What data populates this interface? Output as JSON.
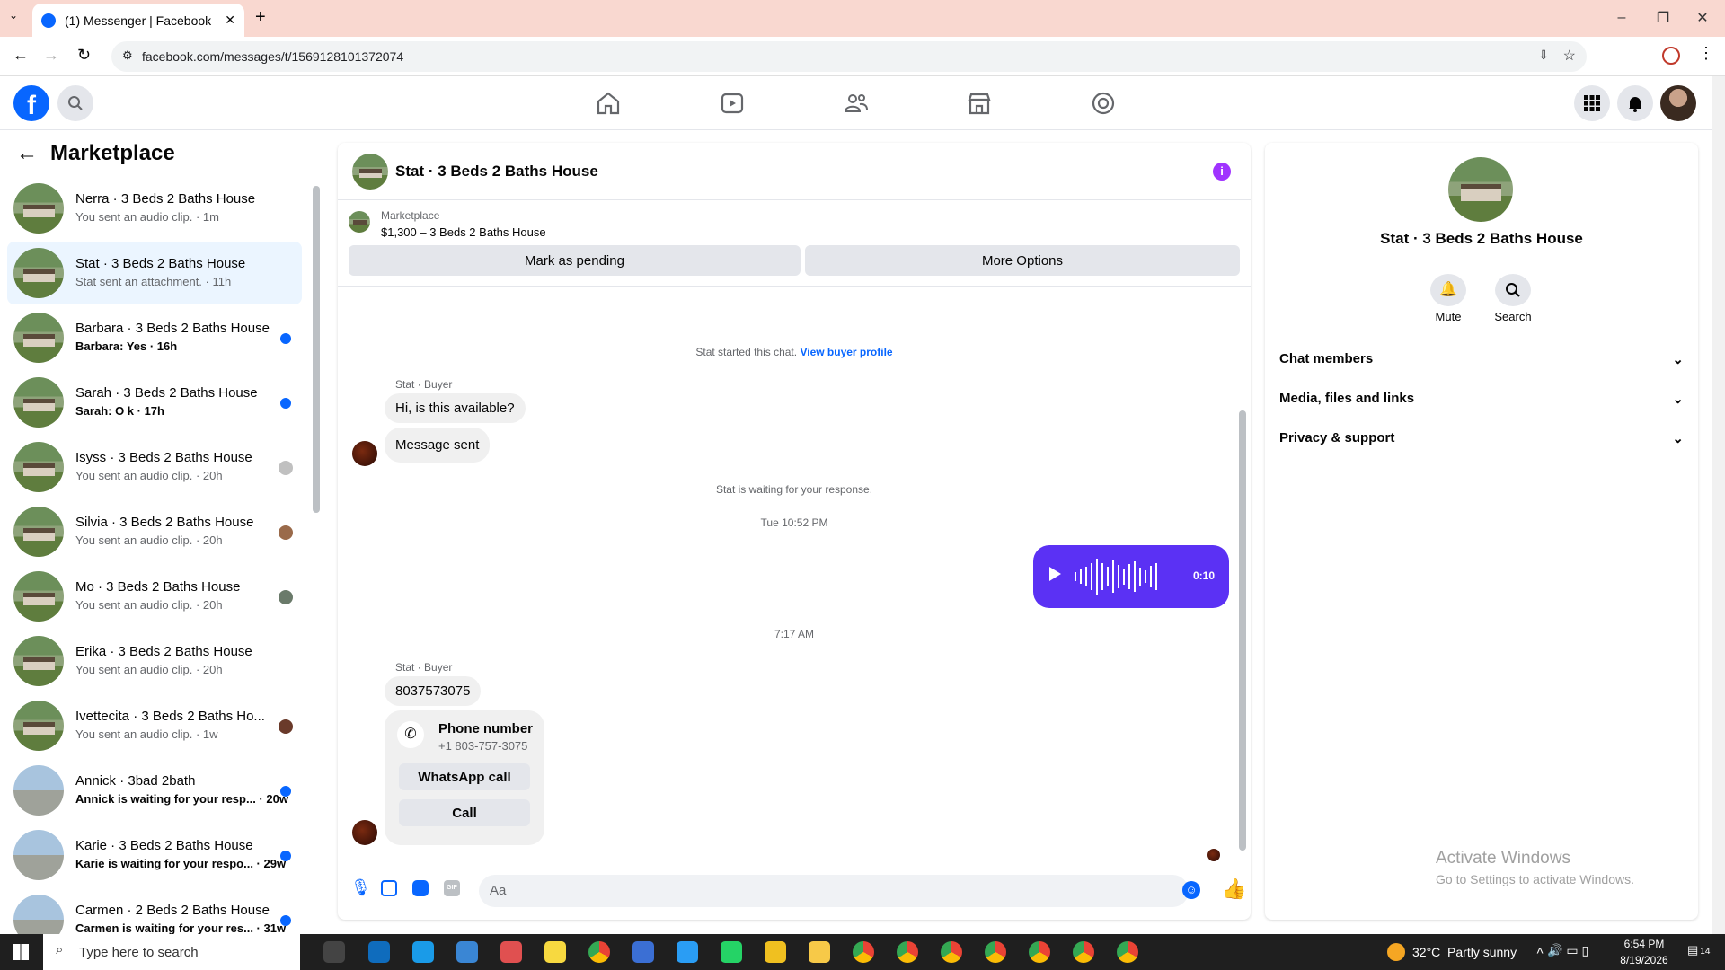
{
  "browser": {
    "tab_title": "(1) Messenger | Facebook",
    "url": "facebook.com/messages/t/1569128101372074"
  },
  "left": {
    "title": "Marketplace",
    "conversations": [
      {
        "name": "Nerra · 3 Beds 2 Baths House",
        "preview": "You sent an audio clip. · 1m",
        "unread": false
      },
      {
        "name": "Stat · 3 Beds 2 Baths House",
        "preview": "Stat sent an attachment. · 11h",
        "unread": false
      },
      {
        "name": "Barbara · 3 Beds 2 Baths House",
        "preview": "Barbara: Yes · 16h",
        "unread": true
      },
      {
        "name": "Sarah · 3 Beds 2 Baths House",
        "preview": "Sarah: O k · 17h",
        "unread": true
      },
      {
        "name": "Isyss · 3 Beds 2 Baths House",
        "preview": "You sent an audio clip. · 20h",
        "unread": false
      },
      {
        "name": "Silvia · 3 Beds 2 Baths House",
        "preview": "You sent an audio clip. · 20h",
        "unread": false
      },
      {
        "name": "Mo · 3 Beds 2 Baths House",
        "preview": "You sent an audio clip. · 20h",
        "unread": false
      },
      {
        "name": "Erika · 3 Beds 2 Baths House",
        "preview": "You sent an audio clip. · 20h",
        "unread": false
      },
      {
        "name": "Ivettecita · 3 Beds 2 Baths Ho...",
        "preview": "You sent an audio clip. · 1w",
        "unread": false
      },
      {
        "name": "Annick · 3bad 2bath",
        "preview": "Annick is waiting for your resp... · 20w",
        "unread": true
      },
      {
        "name": "Karie · 3 Beds 2 Baths House",
        "preview": "Karie is waiting for your respo... · 29w",
        "unread": true
      },
      {
        "name": "Carmen · 2 Beds 2 Baths House",
        "preview": "Carmen is waiting for your res... · 31w",
        "unread": true
      }
    ]
  },
  "chat": {
    "title": "Stat · 3 Beds 2 Baths House",
    "product": {
      "source": "Marketplace",
      "listing": "$1,300 – 3 Beds 2 Baths House"
    },
    "mark_pending": "Mark as pending",
    "more_options": "More Options",
    "started": "Stat started this chat.",
    "view_profile": "View buyer profile",
    "sender1": "Stat · Buyer",
    "msg1": "Hi, is this available?",
    "msg2": "Message sent",
    "waiting": "Stat is waiting for your response.",
    "time1": "Tue 10:52 PM",
    "audio_duration": "0:10",
    "time2": "7:17 AM",
    "sender2": "Stat · Buyer",
    "msg3": "8037573075",
    "phone_title": "Phone number",
    "phone_number": "+1 803-757-3075",
    "whatsapp": "WhatsApp call",
    "call": "Call",
    "composer_placeholder": "Aa"
  },
  "right": {
    "title": "Stat · 3 Beds 2 Baths House",
    "mute": "Mute",
    "search": "Search",
    "sections": [
      "Chat members",
      "Media, files and links",
      "Privacy & support"
    ],
    "watermark1": "Activate Windows",
    "watermark2": "Go to Settings to activate Windows."
  },
  "taskbar": {
    "search": "Type here to search",
    "weather": "32°C  Partly sunny",
    "time": "6:54 PM",
    "date": "8/19/2026",
    "notif": "14"
  },
  "colors": {
    "fb_blue": "#0866ff",
    "audio_bubble": "#5b31f4",
    "info_purple": "#a033ff"
  }
}
